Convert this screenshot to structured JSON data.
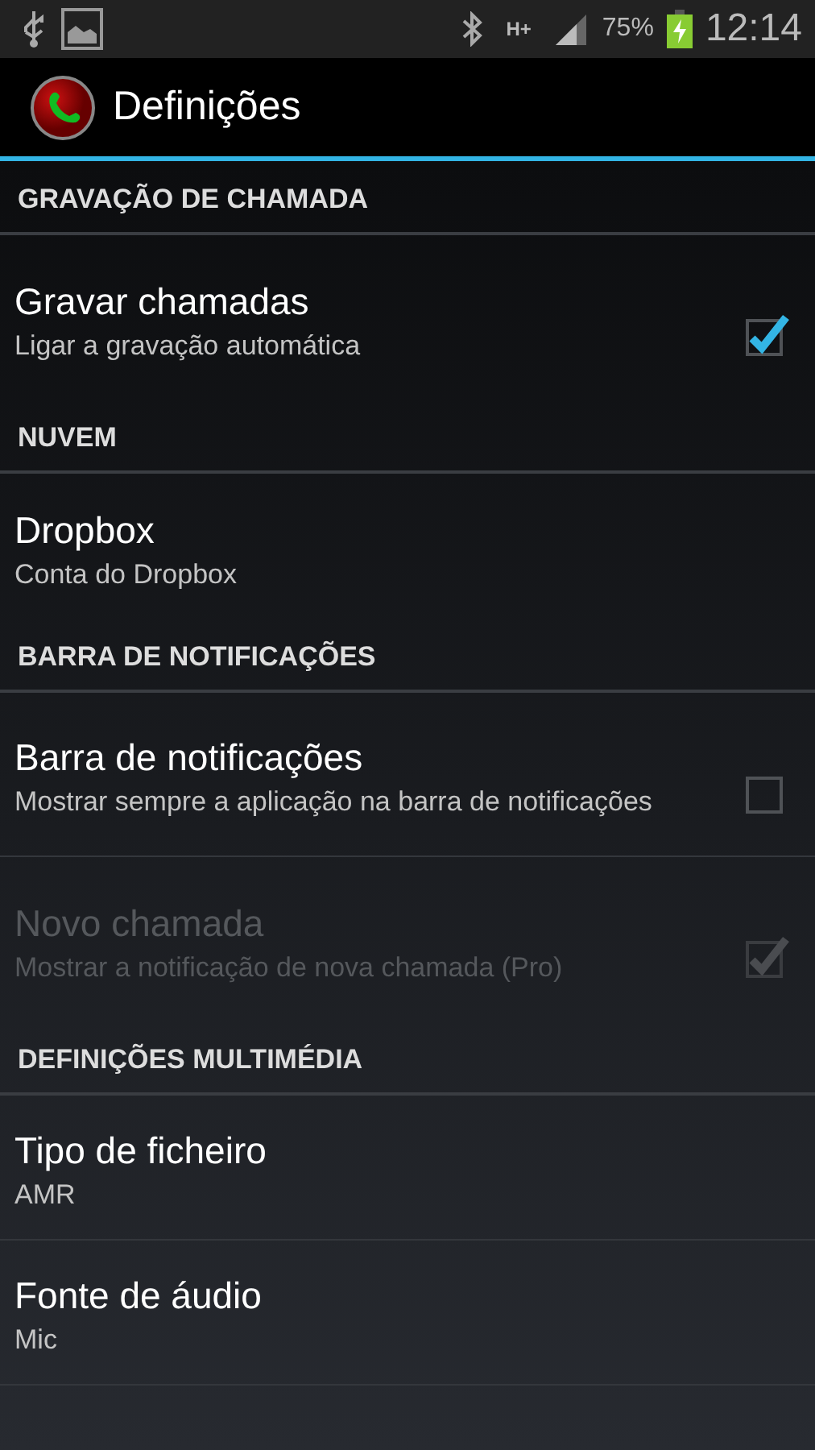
{
  "status_bar": {
    "battery": "75%",
    "time": "12:14",
    "network": "H+"
  },
  "action_bar": {
    "title": "Definições"
  },
  "sections": [
    {
      "header": "GRAVAÇÃO DE CHAMADA",
      "items": [
        {
          "kind": "checkbox",
          "title": "Gravar chamadas",
          "summary": "Ligar a gravação automática",
          "checked": true,
          "disabled": false
        }
      ]
    },
    {
      "header": "NUVEM",
      "items": [
        {
          "kind": "plain",
          "title": "Dropbox",
          "summary": "Conta do Dropbox"
        }
      ]
    },
    {
      "header": "BARRA DE NOTIFICAÇÕES",
      "items": [
        {
          "kind": "checkbox",
          "title": "Barra de notificações",
          "summary": "Mostrar sempre a aplicação na barra de notificações",
          "checked": false,
          "disabled": false
        },
        {
          "kind": "checkbox",
          "title": "Novo chamada",
          "summary": "Mostrar a notificação de nova chamada (Pro)",
          "checked": true,
          "disabled": true
        }
      ]
    },
    {
      "header": "DEFINIÇÕES MULTIMÉDIA",
      "items": [
        {
          "kind": "plain",
          "title": "Tipo de ficheiro",
          "summary": "AMR"
        },
        {
          "kind": "plain",
          "title": "Fonte de áudio",
          "summary": "Mic"
        }
      ]
    }
  ]
}
